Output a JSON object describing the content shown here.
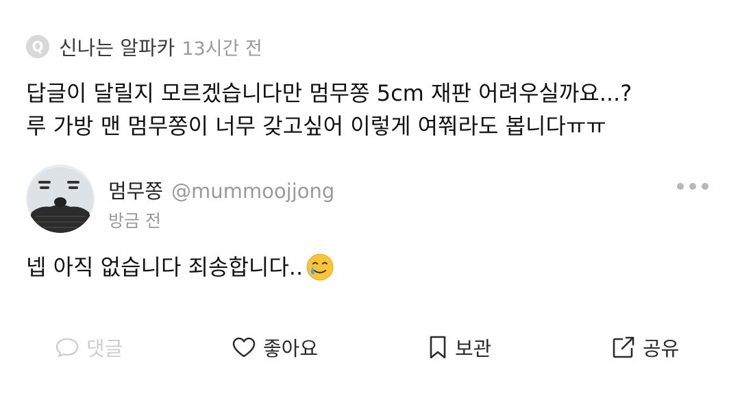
{
  "question": {
    "badge": "Q",
    "asker": "신나는 알파카",
    "time": "13시간 전",
    "lines": [
      "답글이 달릴지 모르겠습니다만 멈무쫑 5cm 재판 어려우실까요...?",
      "루 가방 맨 멈무쫑이 너무 갖고싶어 이렇게 여쭤라도 봅니다ㅠㅠ"
    ]
  },
  "answer": {
    "name": "멈무쫑",
    "handle": "@mummoojjong",
    "time": "방금 전",
    "text": "넵 아직 없습니다 죄송합니다..",
    "emoji_icon": "smiling-face-with-tear-icon"
  },
  "actions": {
    "comment": "댓글",
    "like": "좋아요",
    "bookmark": "보관",
    "share": "공유"
  },
  "colors": {
    "secondary_text": "#9a9a9a",
    "disabled": "#cfcfcf",
    "primary_text": "#111111"
  }
}
